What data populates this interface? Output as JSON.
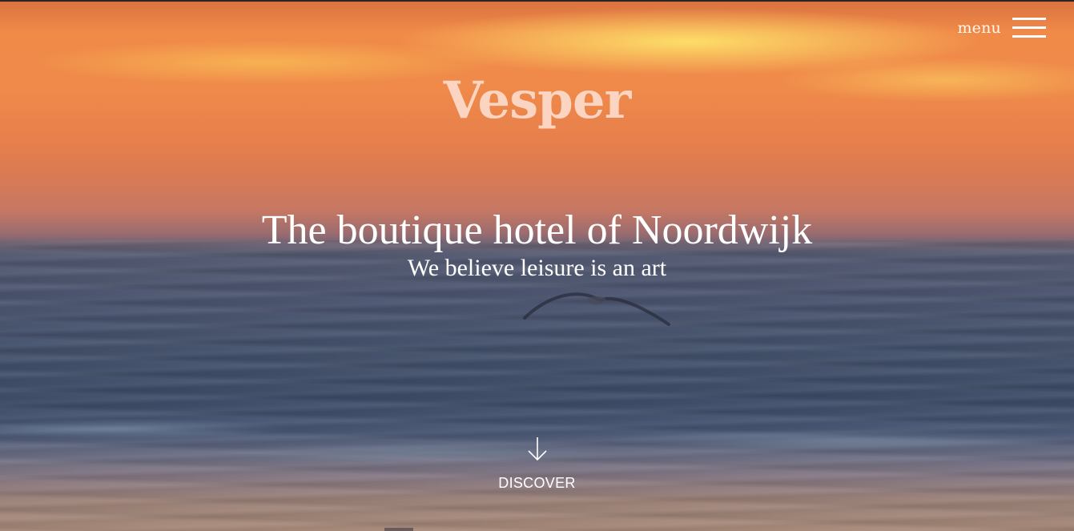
{
  "header": {
    "menu_label": "menu",
    "menu_icon": "hamburger-icon"
  },
  "hero": {
    "logo_text": "Vesper",
    "title": "The boutique hotel of Noordwijk",
    "subtitle": "We believe leisure is an art",
    "discover_label": "DISCOVER",
    "discover_icon": "arrow-down-icon"
  },
  "colors": {
    "logo": "#fbd5c2",
    "text": "#ffffff",
    "sky_orange": "#ef8a4a",
    "sky_yellow": "#ffec6e",
    "sea_blue": "#44526c"
  }
}
